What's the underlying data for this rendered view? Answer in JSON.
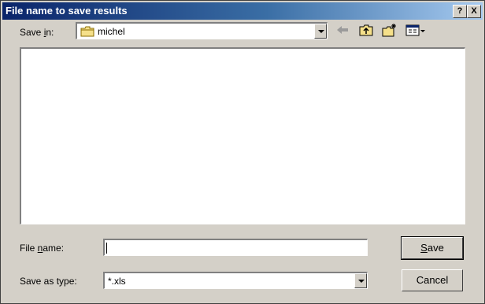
{
  "window": {
    "title": "File name to save results",
    "help_btn": "?",
    "close_btn": "X"
  },
  "save_in": {
    "label_pre": "Save ",
    "label_access": "i",
    "label_post": "n:",
    "value": "michel"
  },
  "file_name": {
    "label_pre": "File ",
    "label_access": "n",
    "label_post": "ame:",
    "value": ""
  },
  "save_as_type": {
    "label": "Save as type:",
    "value": "*.xls"
  },
  "buttons": {
    "save_access": "S",
    "save_rest": "ave",
    "cancel": "Cancel"
  }
}
